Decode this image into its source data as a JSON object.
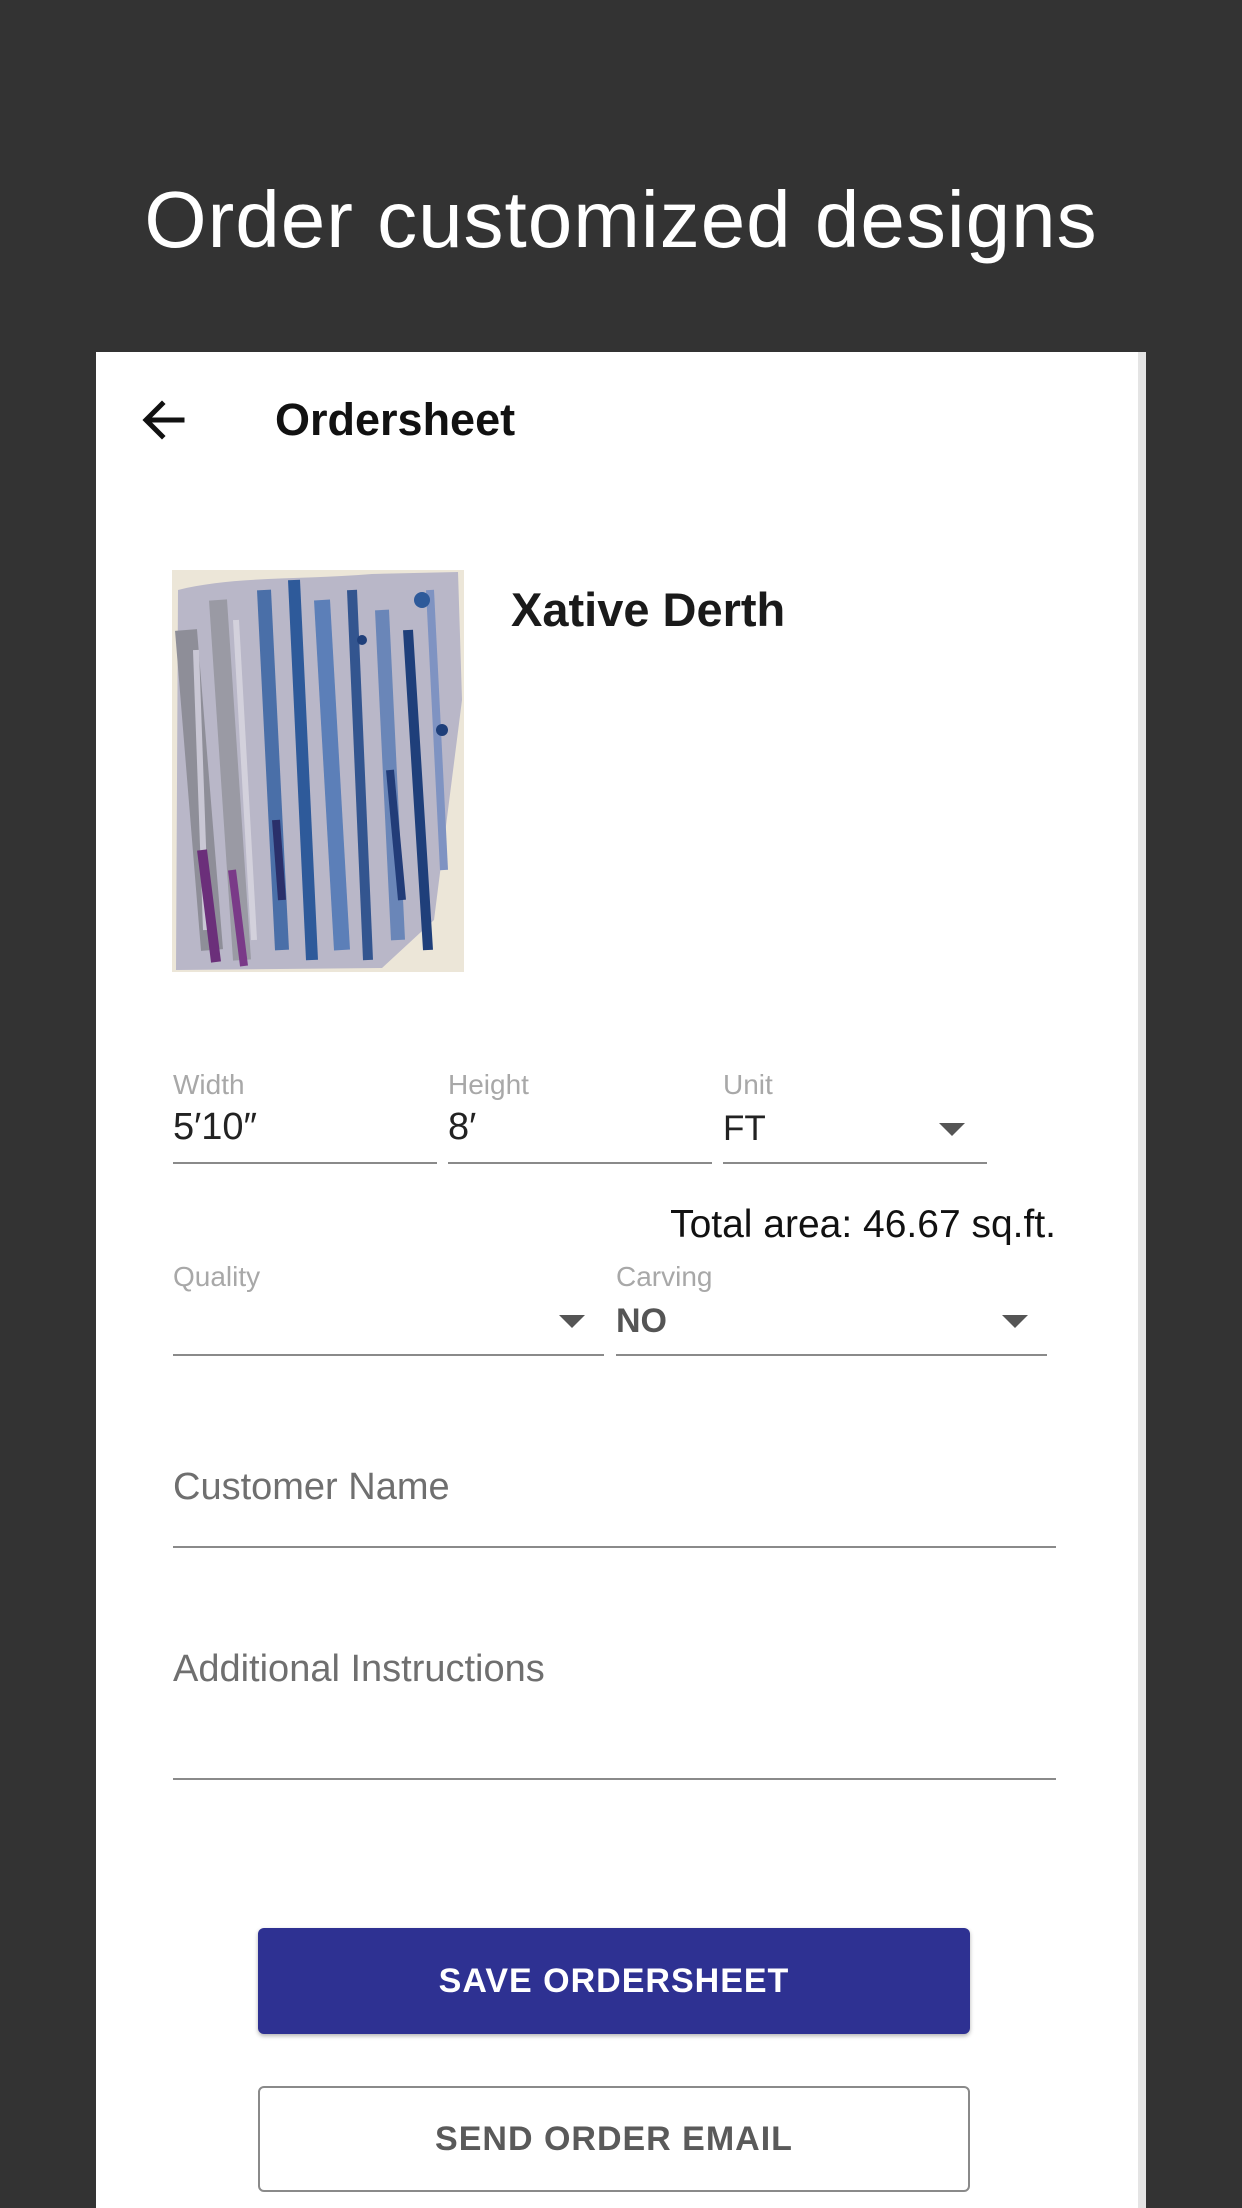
{
  "promo": {
    "title": "Order customized designs"
  },
  "appbar": {
    "back_icon": "arrow-left-icon",
    "title": "Ordersheet"
  },
  "product": {
    "name": "Xative Derth",
    "image_icon": "rug-thumbnail"
  },
  "dimensions": {
    "width_label": "Width",
    "width_value": "5′10″",
    "height_label": "Height",
    "height_value": "8′",
    "unit_label": "Unit",
    "unit_value": "FT"
  },
  "total_area": "Total area: 46.67 sq.ft.",
  "options": {
    "quality_label": "Quality",
    "quality_value": "",
    "carving_label": "Carving",
    "carving_value": "NO"
  },
  "customer": {
    "placeholder": "Customer Name"
  },
  "instructions": {
    "placeholder": "Additional Instructions"
  },
  "actions": {
    "save_label": "SAVE ORDERSHEET",
    "email_label": "SEND ORDER EMAIL"
  },
  "colors": {
    "background": "#333333",
    "primary": "#2e3192",
    "card": "#ffffff"
  }
}
